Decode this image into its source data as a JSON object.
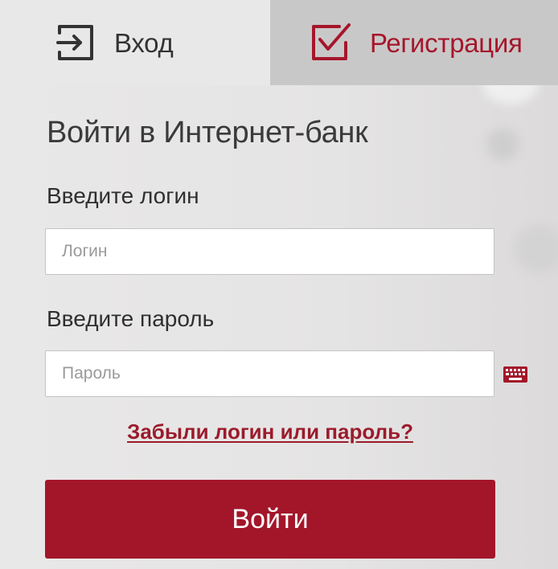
{
  "tabs": {
    "login": {
      "label": "Вход",
      "icon": "login-arrow-icon",
      "active": true
    },
    "register": {
      "label": "Регистрация",
      "icon": "checkbox-check-icon",
      "active": false
    }
  },
  "form": {
    "title": "Войти в Интернет-банк",
    "login_label": "Введите логин",
    "login_placeholder": "Логин",
    "login_value": "",
    "password_label": "Введите пароль",
    "password_placeholder": "Пароль",
    "password_value": "",
    "keyboard_icon": "virtual-keyboard-icon",
    "forgot_link": "Забыли логин или пароль?",
    "submit_label": "Войти"
  },
  "colors": {
    "brand": "#a3162a",
    "link": "#9b1b2c",
    "text": "#333333",
    "inactive_tab_bg": "#c9c8c8",
    "page_bg": "#e7e6e6"
  }
}
